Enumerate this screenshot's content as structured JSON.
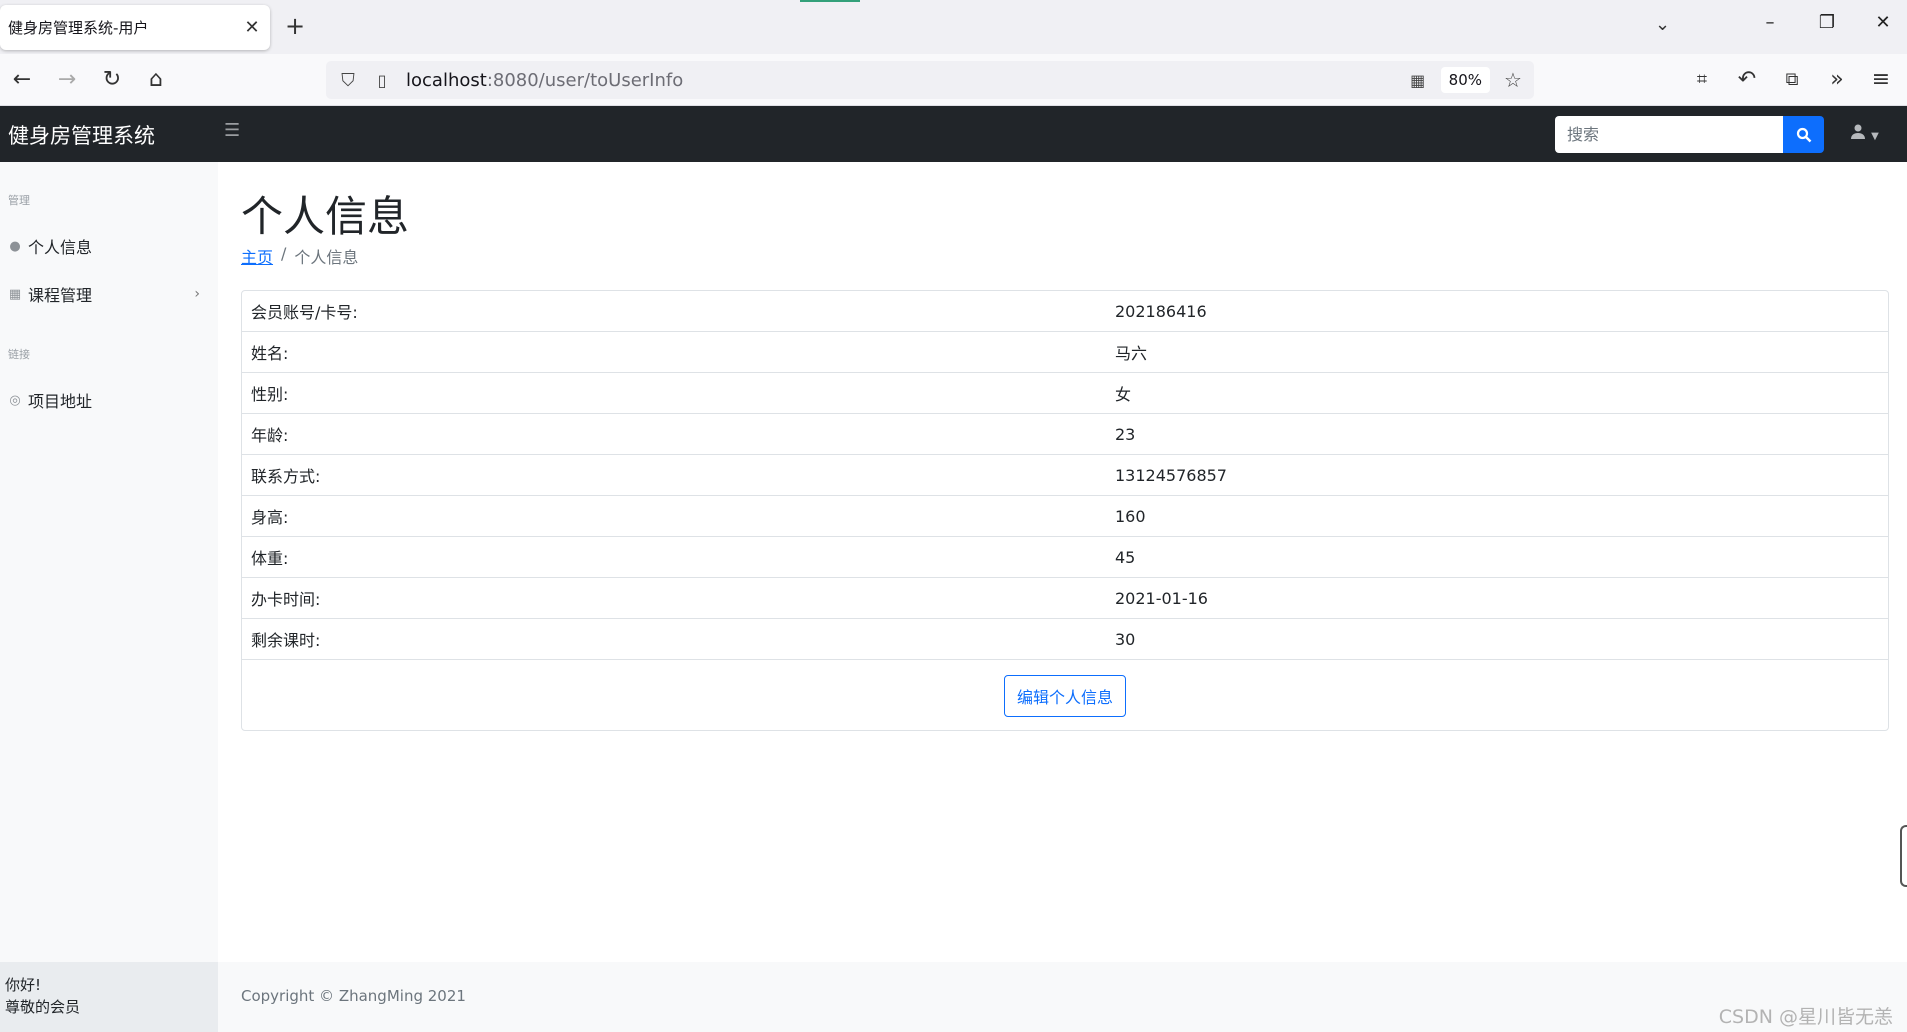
{
  "browser": {
    "tab_title": "健身房管理系统-用户",
    "tab_close": "✕",
    "new_tab": "+",
    "url_host": "localhost",
    "url_path": ":8080/user/toUserInfo",
    "zoom": "80%"
  },
  "app": {
    "brand": "健身房管理系统",
    "search_placeholder": "搜索"
  },
  "sidebar": {
    "heading_manage": "管理",
    "items": [
      {
        "label": "个人信息",
        "icon": "user-icon"
      },
      {
        "label": "课程管理",
        "icon": "calendar-icon"
      }
    ],
    "heading_links": "链接",
    "link_items": [
      {
        "label": "项目地址",
        "icon": "github-icon"
      }
    ],
    "footer_line1": "你好!",
    "footer_line2": "尊敬的会员"
  },
  "main": {
    "title": "个人信息",
    "breadcrumb_home": "主页",
    "breadcrumb_sep": "/",
    "breadcrumb_current": "个人信息",
    "rows": [
      {
        "label": "会员账号/卡号:",
        "value": "202186416"
      },
      {
        "label": "姓名:",
        "value": "马六"
      },
      {
        "label": "性别:",
        "value": "女"
      },
      {
        "label": "年龄:",
        "value": "23"
      },
      {
        "label": "联系方式:",
        "value": "13124576857"
      },
      {
        "label": "身高:",
        "value": "160"
      },
      {
        "label": "体重:",
        "value": "45"
      },
      {
        "label": "办卡时间:",
        "value": "2021-01-16"
      },
      {
        "label": "剩余课时:",
        "value": "30"
      }
    ],
    "edit_button": "编辑个人信息"
  },
  "footer": {
    "copyright": "Copyright © ZhangMing 2021"
  },
  "watermark": "CSDN @星川皆无恙"
}
